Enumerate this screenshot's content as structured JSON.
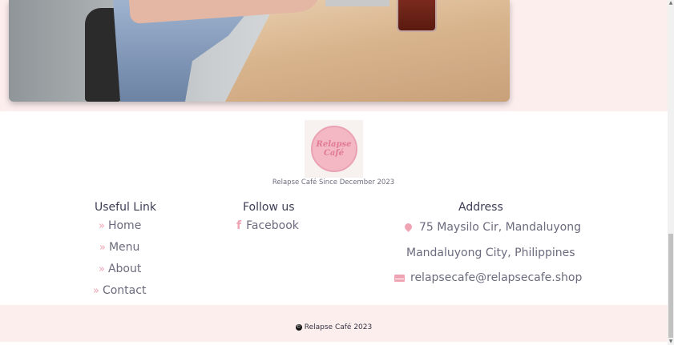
{
  "hero": {
    "image_alt": "person at cafe table with drink"
  },
  "logo": {
    "line1": "Relapse",
    "line2": "Café"
  },
  "since": "Relapse Café Since December 2023",
  "useful_links": {
    "title": "Useful Link",
    "items": [
      {
        "label": "Home"
      },
      {
        "label": "Menu"
      },
      {
        "label": "About"
      },
      {
        "label": "Contact"
      }
    ]
  },
  "follow": {
    "title": "Follow us",
    "items": [
      {
        "label": "Facebook",
        "icon": "facebook-icon"
      }
    ]
  },
  "address": {
    "title": "Address",
    "line1": "75 Maysilo Cir, Mandaluyong",
    "line2": "Mandaluyong City, Philippines",
    "email": "relapsecafe@relapsecafe.shop"
  },
  "footer": {
    "copyright": "Relapse Café 2023"
  },
  "colors": {
    "accent": "#f0a3b3",
    "band": "#fdeeee"
  }
}
